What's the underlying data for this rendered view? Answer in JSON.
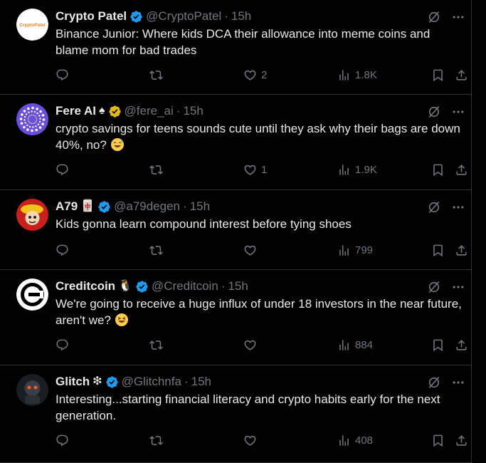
{
  "tweets": [
    {
      "name": "Crypto Patel",
      "extra_badge": "",
      "handle": "@CryptoPatel",
      "time": "15h",
      "text": "Binance Junior: Where kids DCA their allowance into meme coins and blame mom for bad trades",
      "emoji": "",
      "reply_count": "",
      "retweet_count": "",
      "like_count": "2",
      "views": "1.8K",
      "avatar_text": "CryptoPatel",
      "verified_color": "#1d9bf0"
    },
    {
      "name": "Fere AI",
      "extra_badge": "♠",
      "handle": "@fere_ai",
      "time": "15h",
      "text": "crypto savings for teens sounds cute until they ask why their bags are down 40%, no?",
      "emoji": "sweat-smile",
      "reply_count": "",
      "retweet_count": "",
      "like_count": "1",
      "views": "1.9K",
      "avatar_text": "",
      "verified_color": "#e2b719"
    },
    {
      "name": "A79",
      "extra_badge": "🀄",
      "handle": "@a79degen",
      "time": "15h",
      "text": "Kids gonna learn compound interest before tying shoes",
      "emoji": "",
      "reply_count": "",
      "retweet_count": "",
      "like_count": "",
      "views": "799",
      "avatar_text": "",
      "verified_color": "#1d9bf0"
    },
    {
      "name": "Creditcoin",
      "extra_badge": "🐧",
      "handle": "@Creditcoin",
      "time": "15h",
      "text": "We're going to receive a huge influx of under 18 investors in the near future, aren't we?",
      "emoji": "laugh",
      "reply_count": "",
      "retweet_count": "",
      "like_count": "",
      "views": "884",
      "avatar_text": "",
      "verified_color": "#1d9bf0"
    },
    {
      "name": "Glitch",
      "extra_badge": "❇",
      "handle": "@Glitchnfa",
      "time": "15h",
      "text": "Interesting...starting financial literacy and crypto habits early for the next generation.",
      "emoji": "",
      "reply_count": "",
      "retweet_count": "",
      "like_count": "",
      "views": "408",
      "avatar_text": "",
      "verified_color": "#1d9bf0"
    }
  ],
  "colors": {
    "background": "#000000",
    "text": "#e7e9ea",
    "muted": "#71767b",
    "border": "#2f3336",
    "blue_check": "#1d9bf0",
    "gold_check": "#e2b719"
  }
}
